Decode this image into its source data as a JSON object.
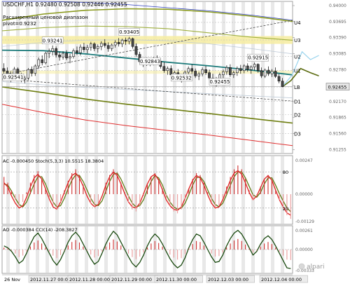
{
  "chart_data": [
    {
      "type": "line",
      "title": "USDCHF,H1  0.92480 0.92508 0.92446 0.92455",
      "subtitle": "Расширенный ценовой диапазон",
      "pivot_label": "pivot=0.9232",
      "ylim": [
        0.9118,
        0.9408
      ],
      "current_price": 0.92455,
      "y_ticks": [
        0.94,
        0.93695,
        0.9339,
        0.93085,
        0.9278,
        0.92475,
        0.9217,
        0.91865,
        0.9156,
        0.91255
      ],
      "y_tick_labels": [
        "0.94000",
        "0.93695",
        "0.93390",
        "0.93085",
        "0.92780",
        "0.92475",
        "0.92170",
        "0.91865",
        "0.91560",
        "0.91255"
      ],
      "levels": [
        {
          "name": "U4",
          "value": 0.9368
        },
        {
          "name": "U3",
          "value": 0.93345
        },
        {
          "name": "U2",
          "value": 0.9303
        },
        {
          "name": "U1",
          "value": 0.92765
        },
        {
          "name": "LB",
          "value": 0.92448
        },
        {
          "name": "D1",
          "value": 0.92175
        },
        {
          "name": "D2",
          "value": 0.9192
        },
        {
          "name": "D3",
          "value": 0.9156
        }
      ],
      "annotations": [
        {
          "text": "0.93405",
          "x": 36,
          "y": 0.93405
        },
        {
          "text": "0.93241",
          "x": 14,
          "y": 0.93241
        },
        {
          "text": "0.92843",
          "x": 42,
          "y": 0.92843
        },
        {
          "text": "0.92915",
          "x": 73,
          "y": 0.92915
        },
        {
          "text": "0.92541",
          "x": 1,
          "y": 0.92541
        },
        {
          "text": "0.92532",
          "x": 51,
          "y": 0.92532
        },
        {
          "text": "0.92455",
          "x": 62,
          "y": 0.92455
        }
      ],
      "candles": [
        [
          0.928,
          0.929,
          0.927,
          0.9275
        ],
        [
          0.9275,
          0.9282,
          0.9262,
          0.9266
        ],
        [
          0.9266,
          0.9275,
          0.9254,
          0.927
        ],
        [
          0.927,
          0.9283,
          0.9265,
          0.9279
        ],
        [
          0.9279,
          0.9282,
          0.9263,
          0.9268
        ],
        [
          0.9268,
          0.9272,
          0.9254,
          0.9259
        ],
        [
          0.9259,
          0.9266,
          0.9252,
          0.9262
        ],
        [
          0.9262,
          0.9281,
          0.9258,
          0.9278
        ],
        [
          0.9278,
          0.9284,
          0.9265,
          0.9271
        ],
        [
          0.9271,
          0.9288,
          0.9266,
          0.9285
        ],
        [
          0.9285,
          0.9301,
          0.928,
          0.9297
        ],
        [
          0.9297,
          0.9305,
          0.9286,
          0.9291
        ],
        [
          0.9291,
          0.9312,
          0.9288,
          0.9309
        ],
        [
          0.9309,
          0.9318,
          0.93,
          0.9313
        ],
        [
          0.9313,
          0.9324,
          0.9305,
          0.9318
        ],
        [
          0.9318,
          0.9322,
          0.9301,
          0.9306
        ],
        [
          0.9306,
          0.9312,
          0.9295,
          0.9302
        ],
        [
          0.9302,
          0.9313,
          0.9297,
          0.9309
        ],
        [
          0.9309,
          0.9315,
          0.9296,
          0.93
        ],
        [
          0.93,
          0.9308,
          0.929,
          0.9303
        ],
        [
          0.9303,
          0.9318,
          0.9299,
          0.9314
        ],
        [
          0.9314,
          0.9322,
          0.9306,
          0.931
        ],
        [
          0.931,
          0.9326,
          0.9305,
          0.9321
        ],
        [
          0.9321,
          0.9329,
          0.9311,
          0.9316
        ],
        [
          0.9316,
          0.9325,
          0.9309,
          0.932
        ],
        [
          0.932,
          0.9331,
          0.9314,
          0.9327
        ],
        [
          0.9327,
          0.933,
          0.9313,
          0.9318
        ],
        [
          0.9318,
          0.9326,
          0.931,
          0.9322
        ],
        [
          0.9322,
          0.9332,
          0.9315,
          0.9328
        ],
        [
          0.9328,
          0.9336,
          0.932,
          0.9324
        ],
        [
          0.9324,
          0.933,
          0.9312,
          0.9318
        ],
        [
          0.9318,
          0.9328,
          0.9313,
          0.9325
        ],
        [
          0.9325,
          0.9334,
          0.932,
          0.933
        ],
        [
          0.933,
          0.9338,
          0.9322,
          0.9327
        ],
        [
          0.9327,
          0.9337,
          0.9321,
          0.9334
        ],
        [
          0.9334,
          0.9339,
          0.9325,
          0.9332
        ],
        [
          0.9332,
          0.93405,
          0.9326,
          0.9337
        ],
        [
          0.9337,
          0.9339,
          0.9318,
          0.9322
        ],
        [
          0.9322,
          0.9328,
          0.9303,
          0.9307
        ],
        [
          0.9307,
          0.9312,
          0.9289,
          0.9293
        ],
        [
          0.9293,
          0.93,
          0.9283,
          0.9297
        ],
        [
          0.9297,
          0.9301,
          0.9285,
          0.929
        ],
        [
          0.929,
          0.9297,
          0.92843,
          0.9288
        ],
        [
          0.9288,
          0.9302,
          0.9286,
          0.9298
        ],
        [
          0.9298,
          0.9305,
          0.929,
          0.9294
        ],
        [
          0.9294,
          0.9299,
          0.928,
          0.9284
        ],
        [
          0.9284,
          0.9292,
          0.9272,
          0.9276
        ],
        [
          0.9276,
          0.9284,
          0.9268,
          0.928
        ],
        [
          0.928,
          0.9286,
          0.9264,
          0.9268
        ],
        [
          0.9268,
          0.9276,
          0.926,
          0.9272
        ],
        [
          0.9272,
          0.9279,
          0.9257,
          0.9261
        ],
        [
          0.9261,
          0.9268,
          0.92532,
          0.9264
        ],
        [
          0.9264,
          0.9276,
          0.9259,
          0.9273
        ],
        [
          0.9273,
          0.9284,
          0.9268,
          0.928
        ],
        [
          0.928,
          0.9288,
          0.927,
          0.9275
        ],
        [
          0.9275,
          0.928,
          0.9262,
          0.9266
        ],
        [
          0.9266,
          0.9274,
          0.9258,
          0.927
        ],
        [
          0.927,
          0.9282,
          0.9265,
          0.9278
        ],
        [
          0.9278,
          0.9285,
          0.9268,
          0.9272
        ],
        [
          0.9272,
          0.9278,
          0.9258,
          0.9262
        ],
        [
          0.9262,
          0.927,
          0.9252,
          0.9256
        ],
        [
          0.9256,
          0.9264,
          0.92455,
          0.926
        ],
        [
          0.926,
          0.9272,
          0.9255,
          0.9268
        ],
        [
          0.9268,
          0.9278,
          0.9262,
          0.9274
        ],
        [
          0.9274,
          0.9286,
          0.9268,
          0.9282
        ],
        [
          0.9282,
          0.9288,
          0.9264,
          0.9268
        ],
        [
          0.9268,
          0.9276,
          0.9262,
          0.9272
        ],
        [
          0.9272,
          0.9284,
          0.9266,
          0.928
        ],
        [
          0.928,
          0.9287,
          0.927,
          0.9276
        ],
        [
          0.9276,
          0.9288,
          0.9271,
          0.9285
        ],
        [
          0.9285,
          0.929,
          0.9274,
          0.9278
        ],
        [
          0.9278,
          0.9286,
          0.927,
          0.9283
        ],
        [
          0.9283,
          0.92915,
          0.9276,
          0.9288
        ],
        [
          0.9288,
          0.929,
          0.9272,
          0.9276
        ],
        [
          0.9276,
          0.9282,
          0.9262,
          0.9266
        ],
        [
          0.9266,
          0.928,
          0.9262,
          0.9277
        ],
        [
          0.9277,
          0.9284,
          0.9266,
          0.927
        ],
        [
          0.927,
          0.9279,
          0.9264,
          0.9275
        ],
        [
          0.9275,
          0.9282,
          0.9262,
          0.9265
        ],
        [
          0.9265,
          0.927,
          0.9252,
          0.9256
        ],
        [
          0.9256,
          0.9262,
          0.92446,
          0.92455
        ]
      ],
      "x_labels": [
        "26 Nov",
        "2012.11.27 00:00",
        "2012.11.28 00:00",
        "2012.11.29 00:00",
        "2012.11.30 00:00",
        "2012.12.03 00:00",
        "2012.12.04 00:00"
      ]
    },
    {
      "type": "line",
      "title": "AC -0.000450  Stoch(5,3,3) 10.5515 18.3804",
      "y_tick_labels": [
        "80",
        "20"
      ],
      "right_labels": [
        "0.00247",
        "0.00000",
        "-0.00129"
      ],
      "stoch_main": [
        62,
        55,
        40,
        28,
        20,
        24,
        38,
        55,
        70,
        76,
        68,
        52,
        35,
        22,
        18,
        30,
        46,
        62,
        74,
        78,
        70,
        56,
        40,
        28,
        22,
        26,
        40,
        58,
        72,
        80,
        74,
        60,
        44,
        30,
        22,
        20,
        28,
        44,
        60,
        72,
        76,
        66,
        50,
        34,
        24,
        18,
        16,
        22,
        36,
        52,
        66,
        74,
        70,
        58,
        42,
        28,
        20,
        22,
        34,
        50,
        66,
        78,
        82,
        76,
        62,
        46,
        34,
        40,
        54,
        68,
        74,
        66,
        50,
        34,
        22,
        12,
        8
      ],
      "stoch_signal": [
        60,
        58,
        48,
        36,
        26,
        22,
        30,
        45,
        60,
        72,
        72,
        60,
        44,
        30,
        22,
        24,
        36,
        52,
        66,
        75,
        74,
        64,
        50,
        36,
        26,
        24,
        32,
        48,
        64,
        76,
        78,
        68,
        54,
        40,
        28,
        22,
        24,
        34,
        50,
        64,
        74,
        70,
        58,
        42,
        30,
        22,
        18,
        20,
        28,
        42,
        58,
        70,
        72,
        64,
        50,
        36,
        26,
        22,
        28,
        42,
        58,
        72,
        80,
        80,
        70,
        56,
        42,
        38,
        46,
        60,
        70,
        70,
        58,
        44,
        32,
        20,
        14
      ],
      "ac_histogram": [
        0.0009,
        0.0006,
        0.0002,
        -0.0003,
        -0.0006,
        -0.0004,
        0.0001,
        0.0006,
        0.001,
        0.0012,
        0.0008,
        0.0003,
        -0.0002,
        -0.0006,
        -0.0008,
        -0.0004,
        0.0002,
        0.0007,
        0.0011,
        0.0013,
        0.001,
        0.0005,
        0.0,
        -0.0005,
        -0.0007,
        -0.0005,
        0.0,
        0.0006,
        0.001,
        0.0013,
        0.0011,
        0.0006,
        0.0001,
        -0.0004,
        -0.0008,
        -0.0009,
        -0.0006,
        -0.0001,
        0.0005,
        0.0009,
        0.0011,
        0.0008,
        0.0003,
        -0.0002,
        -0.0006,
        -0.0009,
        -0.001,
        -0.0008,
        -0.0003,
        0.0003,
        0.0008,
        0.0011,
        0.001,
        0.0006,
        0.0001,
        -0.0004,
        -0.0007,
        -0.0006,
        -0.0002,
        0.0004,
        0.0009,
        0.0013,
        0.0015,
        0.0013,
        0.0008,
        0.0002,
        -0.0003,
        -0.0001,
        0.0004,
        0.0008,
        0.001,
        0.0007,
        0.0002,
        -0.0003,
        -0.0007,
        -0.0011,
        -0.00129
      ]
    },
    {
      "type": "line",
      "title": "AO -0.000384  CCI(14) -208.3827",
      "right_labels": [
        "0.00261",
        "0.00000",
        "-0.00333"
      ],
      "cci": [
        40,
        20,
        -20,
        -80,
        -150,
        -120,
        -40,
        60,
        140,
        180,
        120,
        40,
        -40,
        -120,
        -170,
        -110,
        -20,
        80,
        150,
        190,
        140,
        60,
        -20,
        -100,
        -160,
        -130,
        -40,
        60,
        140,
        200,
        160,
        80,
        0,
        -80,
        -150,
        -190,
        -140,
        -60,
        40,
        120,
        170,
        130,
        60,
        -20,
        -100,
        -160,
        -200,
        -170,
        -90,
        20,
        110,
        170,
        150,
        80,
        0,
        -80,
        -140,
        -130,
        -60,
        40,
        120,
        180,
        210,
        170,
        100,
        20,
        -60,
        -20,
        60,
        120,
        150,
        110,
        40,
        -40,
        -120,
        -200,
        -208
      ]
    }
  ],
  "watermark": "alpari"
}
